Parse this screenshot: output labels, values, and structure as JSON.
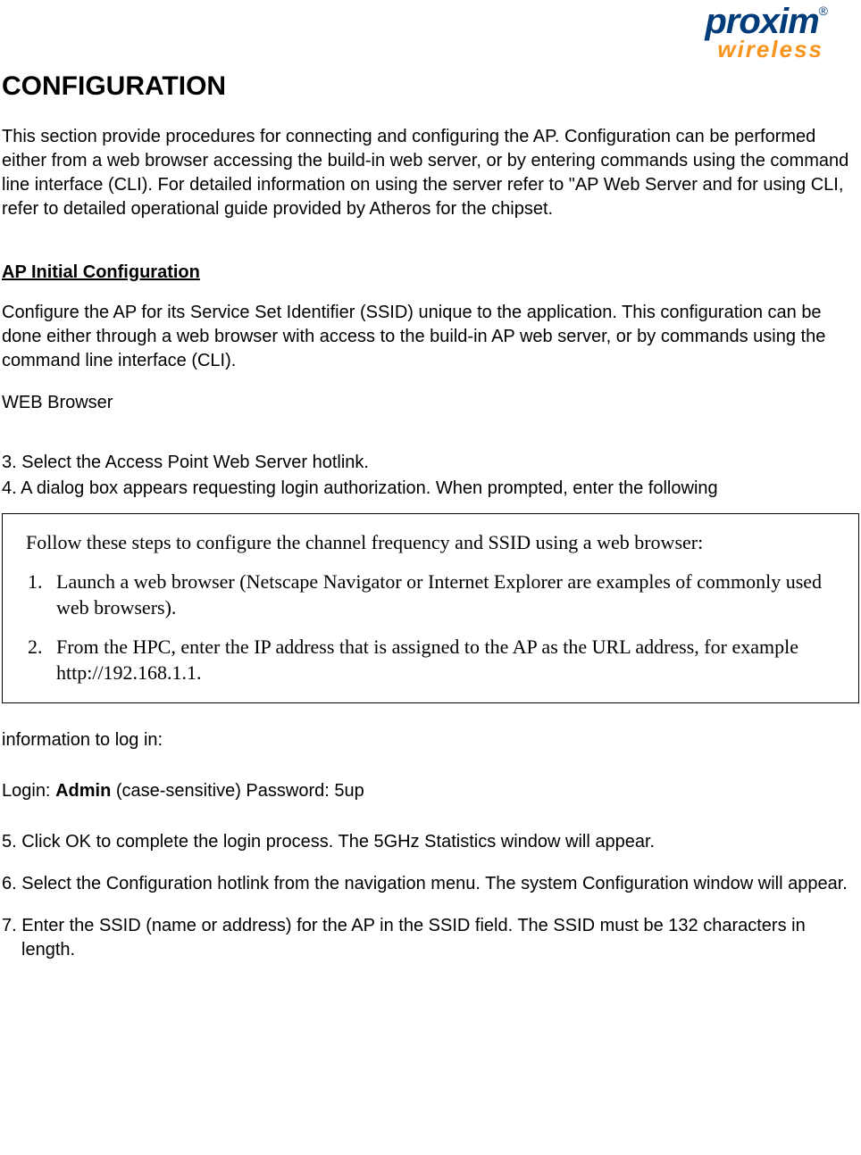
{
  "logo": {
    "top": "proxim",
    "bottom": "wireless",
    "reg": "®"
  },
  "title": "CONFIGURATION",
  "intro": "This section provide procedures for connecting and configuring the AP. Configuration can be performed either from a web browser accessing the build-in web server, or by entering commands using the command line interface (CLI). For detailed information on using the server refer to \"AP Web Server and for using CLI, refer to detailed operational guide provided by Atheros for the chipset.",
  "section_heading": "AP Initial Configuration",
  "section_para": "Configure the AP for its Service Set Identifier (SSID) unique to the application. This configuration can be done either through a web browser with access to the build-in AP web server, or by commands using the command line interface (CLI).",
  "web_browser_label": "WEB Browser",
  "step3": "3. Select the Access Point Web Server hotlink.",
  "step4": "4. A dialog box appears requesting login authorization. When prompted, enter the following",
  "box": {
    "leadin": "Follow these steps to configure the channel frequency and SSID using a web browser:",
    "item1": "Launch a web browser (Netscape Navigator or Internet Explorer are examples of commonly used web browsers).",
    "item2": "From the HPC, enter the IP address that is assigned to the AP as the URL address, for example http://192.168.1.1."
  },
  "info_line": "information to log in:",
  "login_prefix": "Login: ",
  "login_admin": "Admin",
  "login_suffix": " (case-sensitive) Password: 5up",
  "step5": "5. Click OK to complete the login process. The 5GHz Statistics window will appear.",
  "step6": "6. Select the Configuration hotlink from the navigation menu. The system Configuration window will appear.",
  "step7": "7. Enter the SSID (name or address) for the AP in the SSID field. The SSID must be 132 characters in length."
}
